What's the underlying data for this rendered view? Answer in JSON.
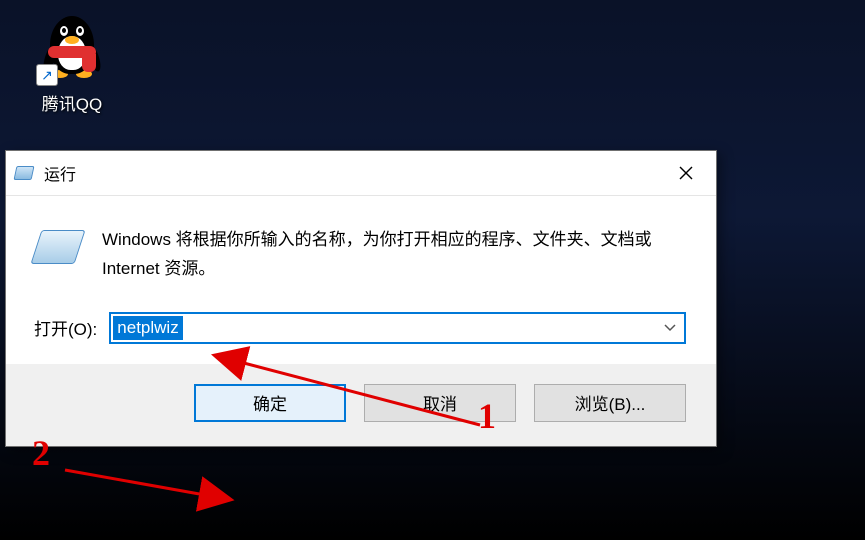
{
  "desktop": {
    "icon_label": "腾讯QQ"
  },
  "dialog": {
    "title": "运行",
    "description": "Windows 将根据你所输入的名称，为你打开相应的程序、文件夹、文档或 Internet 资源。",
    "open_label": "打开(O):",
    "input_value": "netplwiz",
    "buttons": {
      "ok": "确定",
      "cancel": "取消",
      "browse": "浏览(B)..."
    }
  },
  "annotations": {
    "one": "1",
    "two": "2"
  }
}
